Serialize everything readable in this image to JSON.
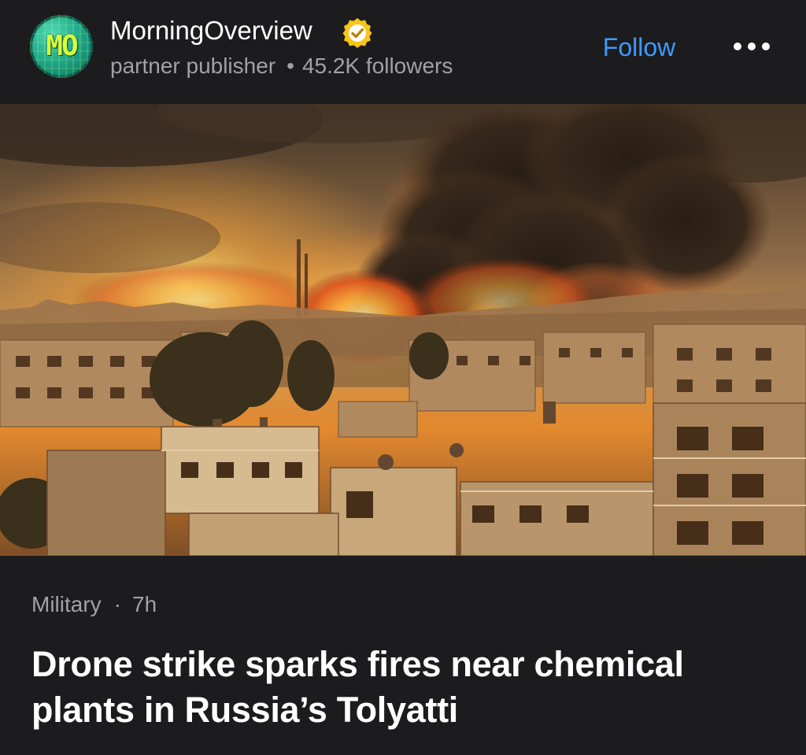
{
  "publisher": {
    "avatar_text": "MO",
    "name": "MorningOverview",
    "type": "partner publisher",
    "followers": "45.2K followers",
    "verified_icon": "verified-badge-icon"
  },
  "actions": {
    "follow_label": "Follow",
    "more_icon": "more-options-icon"
  },
  "hero_image": {
    "subject": "city-fire-smoke-image"
  },
  "article": {
    "category": "Military",
    "separator": "·",
    "age": "7h",
    "headline": "Drone strike sparks fires near chemical plants in Russia’s Tolyatti"
  },
  "colors": {
    "background": "#1c1c1e",
    "accent": "#3d9bff",
    "secondary_text": "#a1a1a6",
    "verified_badge": "#f5c518"
  }
}
